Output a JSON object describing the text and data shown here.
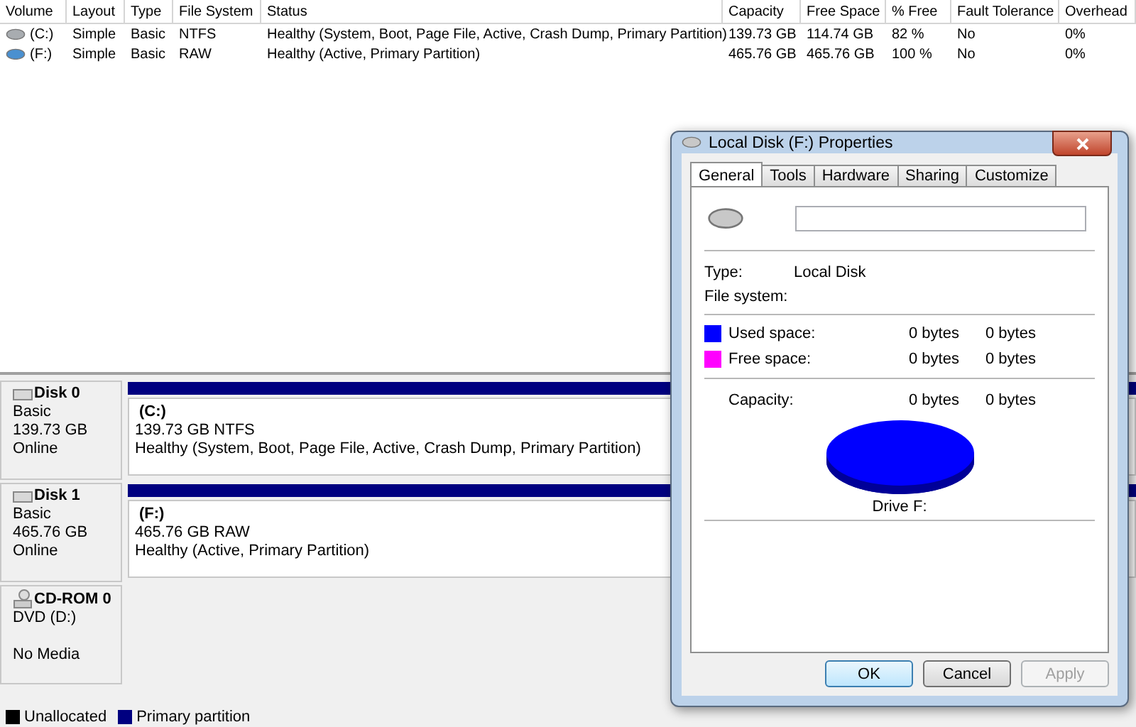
{
  "volume_table": {
    "columns": [
      "Volume",
      "Layout",
      "Type",
      "File System",
      "Status",
      "Capacity",
      "Free Space",
      "% Free",
      "Fault Tolerance",
      "Overhead"
    ],
    "rows": [
      {
        "color": "#a8acb0",
        "cells": [
          "(C:)",
          "Simple",
          "Basic",
          "NTFS",
          "Healthy (System, Boot, Page File, Active, Crash Dump, Primary Partition)",
          "139.73 GB",
          "114.74 GB",
          "82 %",
          "No",
          "0%"
        ]
      },
      {
        "color": "#4a90d0",
        "cells": [
          "(F:)",
          "Simple",
          "Basic",
          "RAW",
          "Healthy (Active, Primary Partition)",
          "465.76 GB",
          "465.76 GB",
          "100 %",
          "No",
          "0%"
        ]
      }
    ]
  },
  "disks": [
    {
      "kind": "disk",
      "name": "Disk 0",
      "lines": [
        "Basic",
        "139.73 GB",
        "Online"
      ],
      "partition": {
        "letter": "(C:)",
        "size": "139.73 GB NTFS",
        "status": "Healthy (System, Boot, Page File, Active, Crash Dump, Primary Partition)"
      }
    },
    {
      "kind": "disk",
      "name": "Disk 1",
      "lines": [
        "Basic",
        "465.76 GB",
        "Online"
      ],
      "partition": {
        "letter": "(F:)",
        "size": "465.76 GB RAW",
        "status": "Healthy (Active, Primary Partition)"
      }
    },
    {
      "kind": "cdrom",
      "name": "CD-ROM 0",
      "lines": [
        "DVD (D:)",
        "No Media"
      ]
    }
  ],
  "legend": [
    {
      "label": "Unallocated",
      "color": "#000000"
    },
    {
      "label": "Primary partition",
      "color": "#000080"
    }
  ],
  "dialog": {
    "title": "Local Disk (F:) Properties",
    "tabs": [
      {
        "label": "General",
        "selected": true
      },
      {
        "label": "Tools",
        "selected": false
      },
      {
        "label": "Hardware",
        "selected": false
      },
      {
        "label": "Sharing",
        "selected": false
      },
      {
        "label": "Customize",
        "selected": false
      }
    ],
    "type_label": "Type:",
    "type_value": "Local Disk",
    "fs_label": "File system:",
    "space": [
      {
        "label": "Used space:",
        "color": "#0000ff",
        "bytes": "0 bytes",
        "size": "0 bytes"
      },
      {
        "label": "Free space:",
        "color": "#ff00ff",
        "bytes": "0 bytes",
        "size": "0 bytes"
      }
    ],
    "capacity": {
      "label": "Capacity:",
      "bytes": "0 bytes",
      "size": "0 bytes"
    },
    "drive_label": "Drive F:",
    "buttons": [
      {
        "label": "OK",
        "default": true,
        "disabled": false
      },
      {
        "label": "Cancel",
        "default": false,
        "disabled": false
      },
      {
        "label": "Apply",
        "default": false,
        "disabled": true
      }
    ]
  }
}
